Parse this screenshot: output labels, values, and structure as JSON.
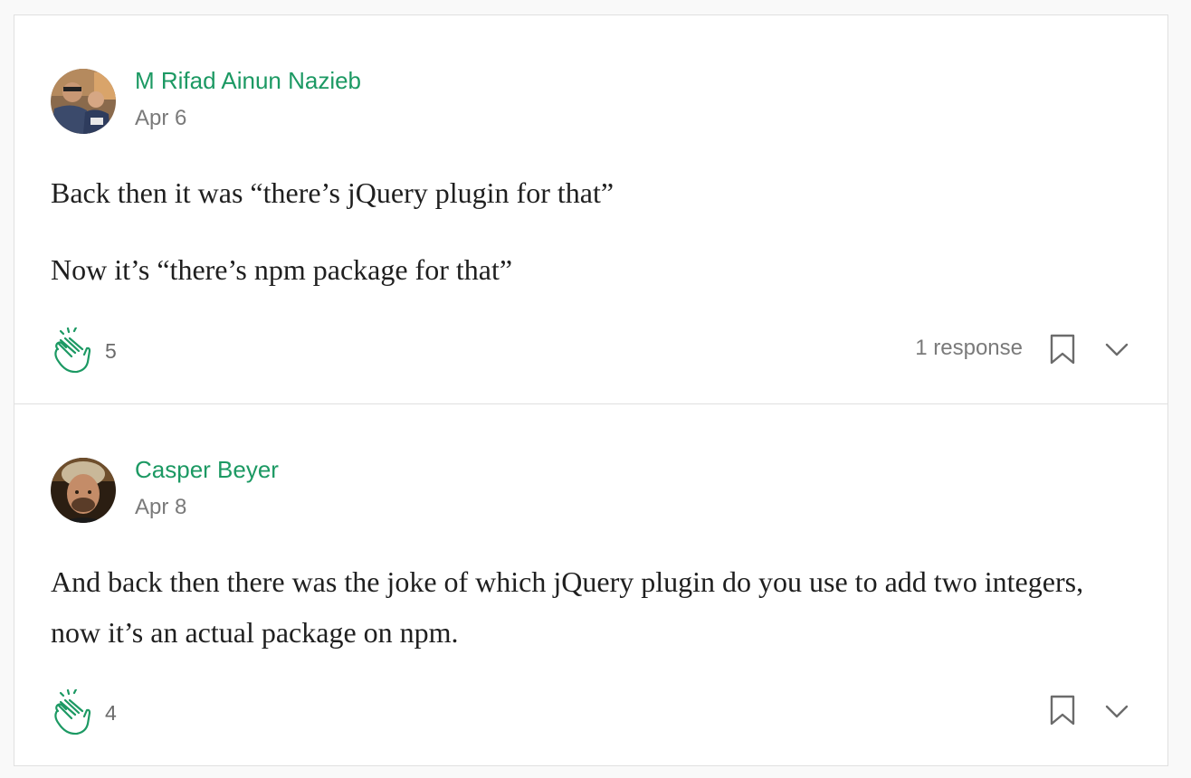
{
  "colors": {
    "accent": "#1c9963",
    "text": "#1f1f1f",
    "meta": "#7a7a7a",
    "card_border": "#e0e0e0",
    "page_bg": "#f9f9f9"
  },
  "comments": [
    {
      "author": "M Rifad Ainun Nazieb",
      "date": "Apr 6",
      "avatar_icon": "avatar-photo",
      "paragraphs": [
        "Back then it was “there’s jQuery plugin for that”",
        "Now it’s “there’s npm package for that”"
      ],
      "claps": "5",
      "responses": "1 response",
      "icons": [
        "clap-icon",
        "bookmark-icon",
        "chevron-down-icon"
      ]
    },
    {
      "author": "Casper Beyer",
      "date": "Apr 8",
      "avatar_icon": "avatar-photo",
      "paragraphs": [
        "And back then there was the joke of which jQuery plugin do you use to add two integers, now it’s an actual package on npm."
      ],
      "claps": "4",
      "icons": [
        "clap-icon",
        "bookmark-icon",
        "chevron-down-icon"
      ]
    }
  ]
}
